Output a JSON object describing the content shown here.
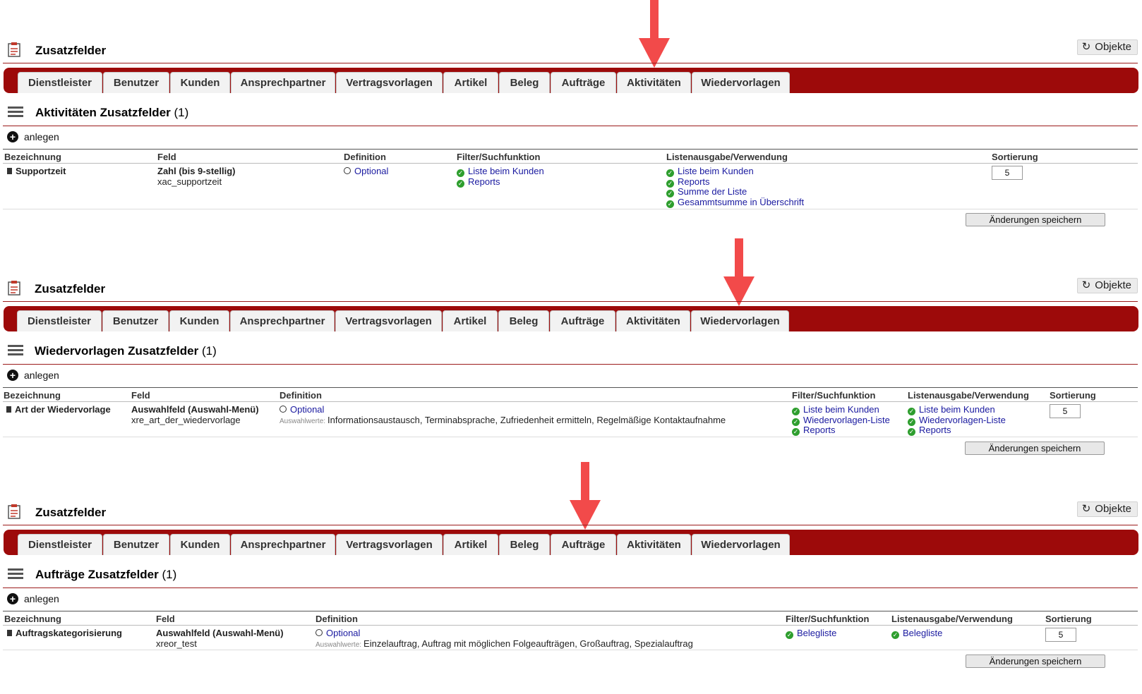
{
  "app": {
    "title": "Zusatzfelder",
    "objekte_label": "Objekte"
  },
  "tabs": [
    "Dienstleister",
    "Benutzer",
    "Kunden",
    "Ansprechpartner",
    "Vertragsvorlagen",
    "Artikel",
    "Beleg",
    "Aufträge",
    "Aktivitäten",
    "Wiedervorlagen"
  ],
  "actions": {
    "anlegen": "anlegen",
    "save": "Änderungen speichern"
  },
  "columns": {
    "bezeichnung": "Bezeichnung",
    "feld": "Feld",
    "definition": "Definition",
    "filter": "Filter/Suchfunktion",
    "liste": "Listenausgabe/Verwendung",
    "sortierung": "Sortierung",
    "auswahlwerte_label": "Auswahlwerte:"
  },
  "panels": [
    {
      "section_title": "Aktivitäten Zusatzfelder",
      "count": "(1)",
      "row": {
        "bezeichnung": "Supportzeit",
        "feld_type": "Zahl (bis 9-stellig)",
        "feld_name": "xac_supportzeit",
        "definition": "Optional",
        "auswahlwerte": "",
        "filter": [
          "Liste beim Kunden",
          "Reports"
        ],
        "liste": [
          "Liste beim Kunden",
          "Reports",
          "Summe der Liste",
          "Gesammtsumme in Überschrift"
        ],
        "sortierung": "5"
      }
    },
    {
      "section_title": "Wiedervorlagen Zusatzfelder",
      "count": "(1)",
      "row": {
        "bezeichnung": "Art der Wiedervorlage",
        "feld_type": "Auswahlfeld (Auswahl-Menü)",
        "feld_name": "xre_art_der_wiedervorlage",
        "definition": "Optional",
        "auswahlwerte": "Informationsaustausch, Terminabsprache, Zufriedenheit ermitteln, Regelmäßige Kontaktaufnahme",
        "filter": [
          "Liste beim Kunden",
          "Wiedervorlagen-Liste",
          "Reports"
        ],
        "liste": [
          "Liste beim Kunden",
          "Wiedervorlagen-Liste",
          "Reports"
        ],
        "sortierung": "5"
      }
    },
    {
      "section_title": "Aufträge Zusatzfelder",
      "count": "(1)",
      "row": {
        "bezeichnung": "Auftragskategorisierung",
        "feld_type": "Auswahlfeld (Auswahl-Menü)",
        "feld_name": "xreor_test",
        "definition": "Optional",
        "auswahlwerte": "Einzelauftrag, Auftrag mit möglichen Folgeaufträgen, Großauftrag, Spezialauftrag",
        "filter": [
          "Belegliste"
        ],
        "liste": [
          "Belegliste"
        ],
        "sortierung": "5"
      }
    }
  ],
  "colors": {
    "accent": "#9d0a0a",
    "link": "#1a1aa0",
    "check": "#2e9e2e",
    "arrow": "#f24a4a"
  }
}
